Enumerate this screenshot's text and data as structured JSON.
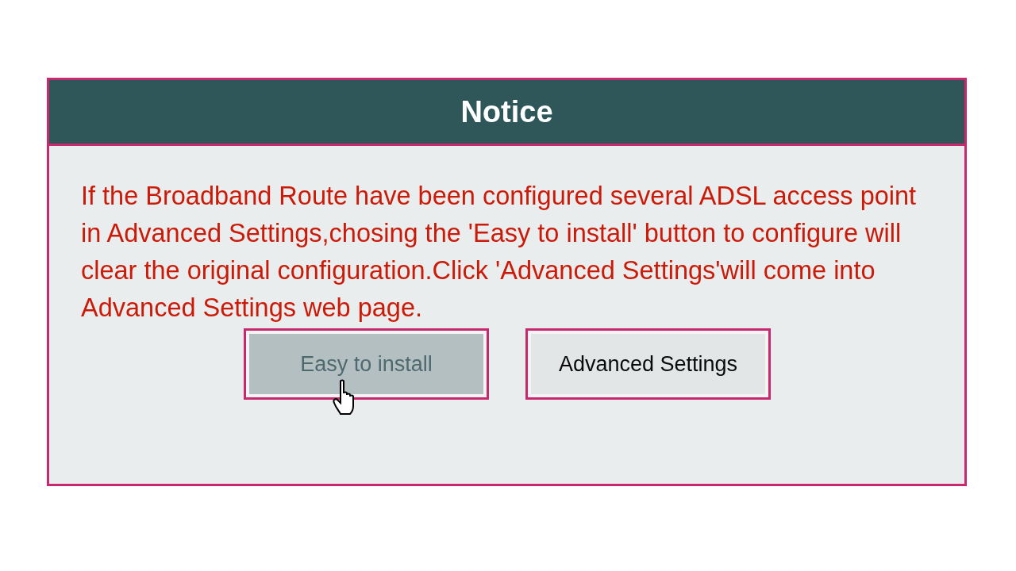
{
  "dialog": {
    "title": "Notice",
    "message": "If the Broadband Route have been configured several ADSL access point in Advanced Settings,chosing the 'Easy to install' button to configure will clear the original configuration.Click 'Advanced Settings'will come into Advanced Settings web page.",
    "buttons": [
      {
        "label": "Easy to install",
        "hovered": true
      },
      {
        "label": "Advanced Settings",
        "hovered": false
      }
    ]
  }
}
